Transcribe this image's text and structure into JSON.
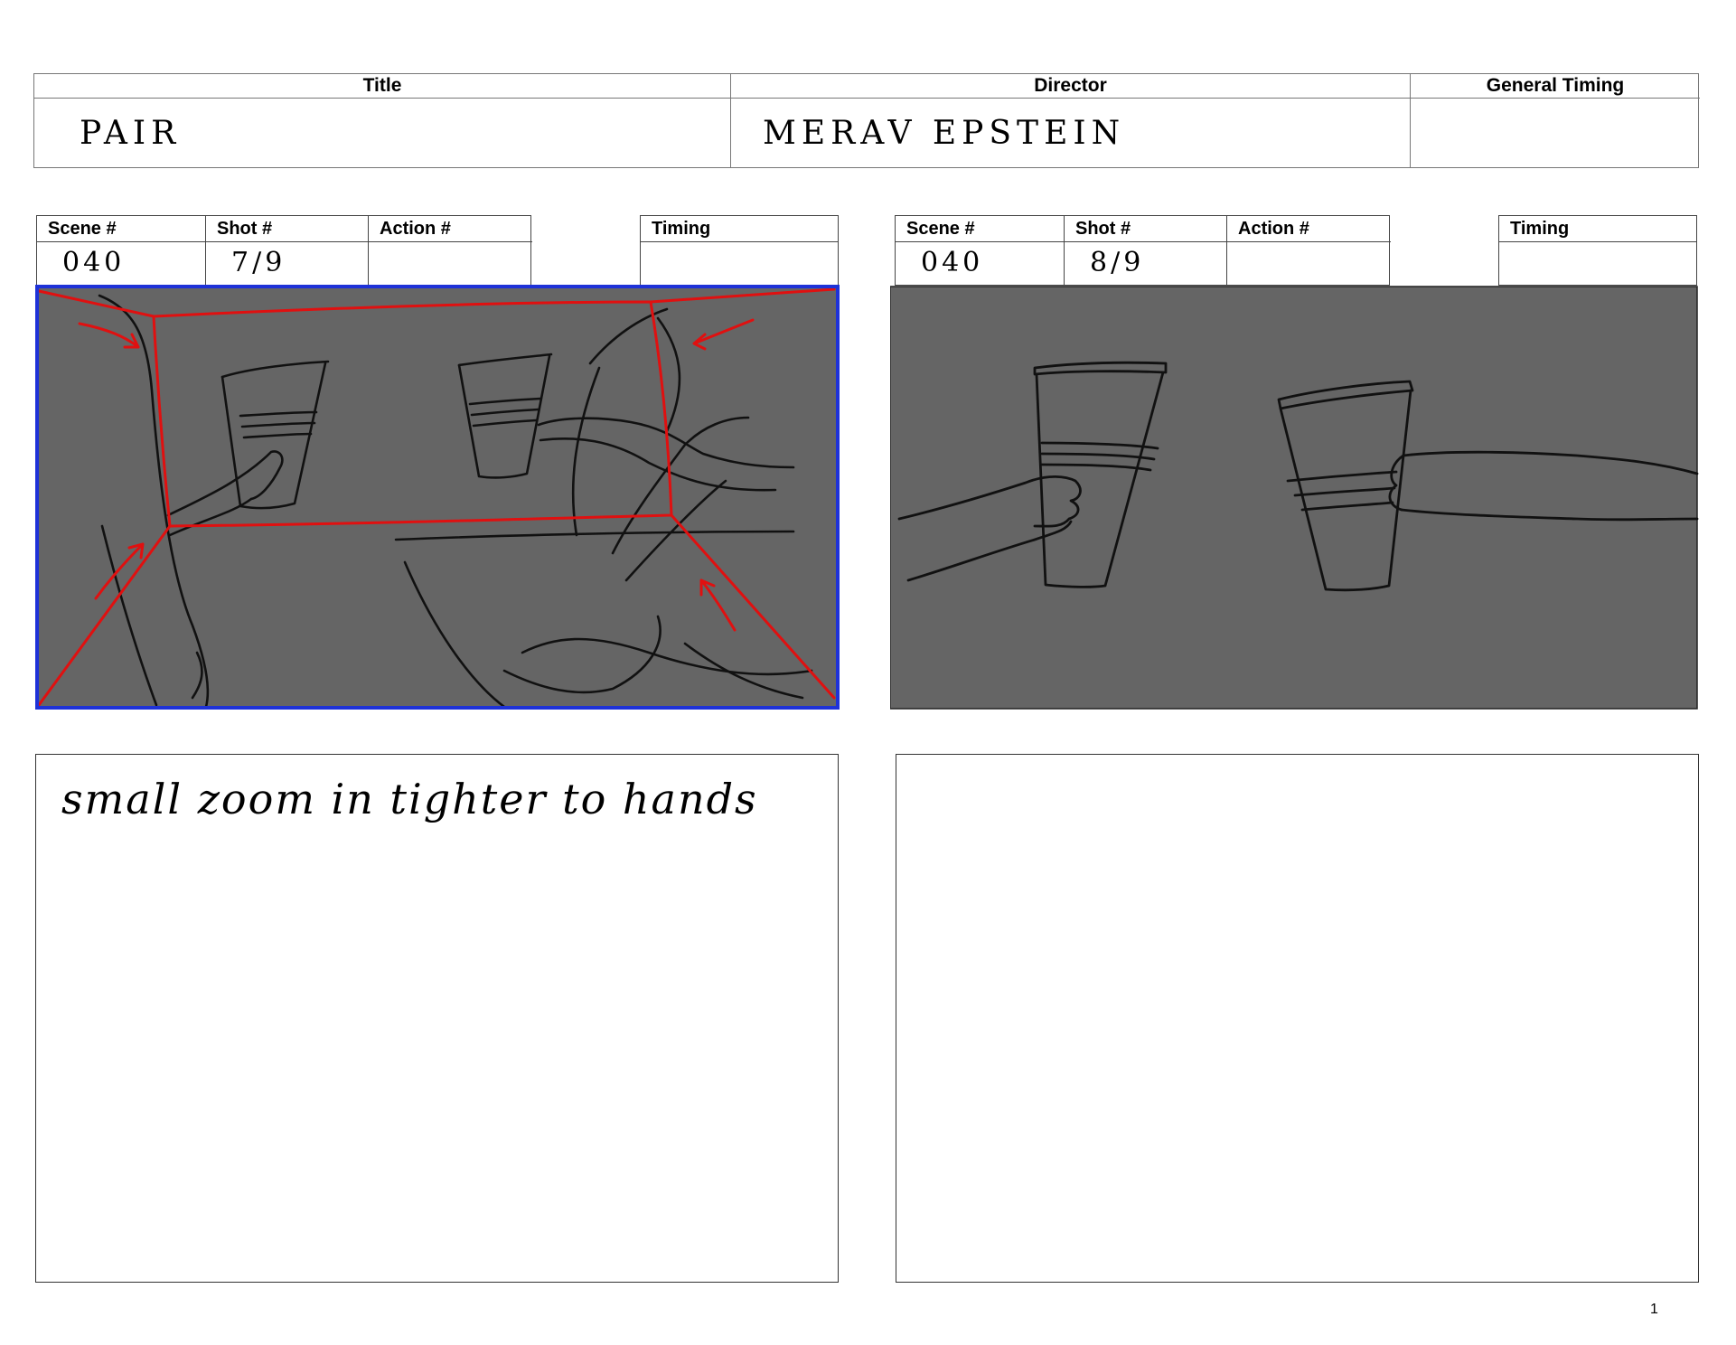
{
  "header": {
    "title_label": "Title",
    "title_value": "PAIR",
    "director_label": "Director",
    "director_value": "MERAV EPSTEIN",
    "timing_label": "General Timing",
    "timing_value": ""
  },
  "panels": [
    {
      "scene_label": "Scene #",
      "scene_value": "040",
      "shot_label": "Shot #",
      "shot_value": "7/9",
      "action_label": "Action #",
      "action_value": "",
      "timing_label": "Timing",
      "timing_value": "",
      "notes": "small zoom in tighter to hands"
    },
    {
      "scene_label": "Scene #",
      "scene_value": "040",
      "shot_label": "Shot #",
      "shot_value": "8/9",
      "action_label": "Action #",
      "action_value": "",
      "timing_label": "Timing",
      "timing_value": "",
      "notes": ""
    }
  ],
  "page_number": "1",
  "colors": {
    "frame_fill": "#656565",
    "sketch_line": "#111111",
    "zoom_box": "#e01010",
    "frame_outline": "#1e32d8"
  }
}
